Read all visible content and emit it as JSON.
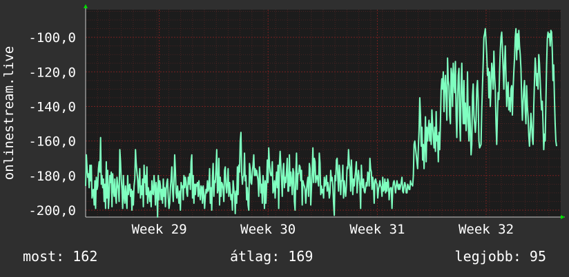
{
  "chart_data": {
    "type": "line",
    "ylabel": "onlinestream.live",
    "ylim": [
      -204,
      -84
    ],
    "yticks": [
      -100,
      -120,
      -140,
      -160,
      -180,
      -200
    ],
    "ytick_labels": [
      "-100,0",
      "-120,0",
      "-140,0",
      "-160,0",
      "-180,0",
      "-200,0"
    ],
    "xticks": [
      "Week 29",
      "Week 30",
      "Week 31",
      "Week 32"
    ],
    "xtick_positions": [
      0.155,
      0.384,
      0.614,
      0.843
    ],
    "grid": true,
    "colors": {
      "background": "#2f2f2f",
      "plot_bg": "#1c1c1c",
      "grid": "#7a2020",
      "line": "#7fffc0",
      "axis_arrow": "#00dd00"
    },
    "series": [
      {
        "values": [
          -186,
          -168,
          -176,
          -181,
          -179,
          -187,
          -174,
          -183,
          -174,
          -193,
          -190,
          -188,
          -197,
          -183,
          -199,
          -181,
          -188,
          -186,
          -176,
          -172,
          -178,
          -158,
          -185,
          -180,
          -187,
          -182,
          -195,
          -185,
          -199,
          -172,
          -193,
          -177,
          -199,
          -192,
          -180,
          -184,
          -178,
          -198,
          -179,
          -188,
          -192,
          -182,
          -192,
          -196,
          -181,
          -185,
          -188,
          -195,
          -165,
          -172,
          -182,
          -188,
          -199,
          -180,
          -192,
          -196,
          -186,
          -193,
          -199,
          -180,
          -191,
          -186,
          -185,
          -192,
          -188,
          -200,
          -189,
          -197,
          -186,
          -182,
          -165,
          -173,
          -178,
          -182,
          -190,
          -184,
          -176,
          -193,
          -186,
          -191,
          -182,
          -198,
          -174,
          -184,
          -180,
          -191,
          -175,
          -196,
          -187,
          -190,
          -195,
          -189,
          -198,
          -183,
          -190,
          -191,
          -180,
          -186,
          -197,
          -184,
          -189,
          -204,
          -180,
          -194,
          -183,
          -186,
          -194,
          -188,
          -196,
          -182,
          -192,
          -187,
          -198,
          -188,
          -184,
          -182,
          -193,
          -199,
          -196,
          -187,
          -182,
          -175,
          -188,
          -195,
          -184,
          -168,
          -177,
          -190,
          -193,
          -186,
          -191,
          -196,
          -189,
          -200,
          -184,
          -187,
          -186,
          -194,
          -180,
          -187,
          -181,
          -184,
          -190,
          -192,
          -181,
          -185,
          -179,
          -188,
          -172,
          -168,
          -193,
          -180,
          -196,
          -185,
          -191,
          -185,
          -186,
          -184,
          -192,
          -183,
          -190,
          -194,
          -186,
          -187,
          -196,
          -186,
          -191,
          -199,
          -192,
          -188,
          -190,
          -183,
          -189,
          -187,
          -176,
          -196,
          -187,
          -200,
          -181,
          -173,
          -192,
          -183,
          -184,
          -176,
          -165,
          -190,
          -188,
          -170,
          -197,
          -181,
          -192,
          -184,
          -185,
          -188,
          -195,
          -177,
          -175,
          -186,
          -190,
          -184,
          -176,
          -192,
          -184,
          -189,
          -194,
          -191,
          -200,
          -183,
          -188,
          -191,
          -202,
          -189,
          -196,
          -175,
          -191,
          -174,
          -178,
          -160,
          -155,
          -178,
          -185,
          -181,
          -180,
          -167,
          -183,
          -180,
          -194,
          -187,
          -197,
          -200,
          -173,
          -176,
          -184,
          -185,
          -178,
          -174,
          -168,
          -180,
          -176,
          -180,
          -177,
          -180,
          -183,
          -192,
          -175,
          -181,
          -190,
          -185,
          -196,
          -180,
          -185,
          -199,
          -183,
          -196,
          -186,
          -171,
          -184,
          -164,
          -173,
          -178,
          -180,
          -180,
          -172,
          -190,
          -188,
          -183,
          -193,
          -184,
          -178,
          -187,
          -174,
          -199,
          -174,
          -166,
          -174,
          -182,
          -192,
          -177,
          -173,
          -187,
          -181,
          -184,
          -177,
          -170,
          -189,
          -189,
          -168,
          -186,
          -178,
          -183,
          -191,
          -176,
          -178,
          -195,
          -200,
          -180,
          -167,
          -188,
          -179,
          -179,
          -174,
          -175,
          -183,
          -177,
          -197,
          -183,
          -185,
          -186,
          -188,
          -196,
          -189,
          -184,
          -181,
          -192,
          -173,
          -176,
          -197,
          -187,
          -178,
          -164,
          -184,
          -170,
          -172,
          -184,
          -181,
          -180,
          -183,
          -186,
          -167,
          -173,
          -191,
          -186,
          -190,
          -188,
          -193,
          -181,
          -186,
          -184,
          -180,
          -189,
          -184,
          -187,
          -193,
          -190,
          -177,
          -183,
          -181,
          -186,
          -196,
          -203,
          -180,
          -183,
          -171,
          -170,
          -181,
          -189,
          -174,
          -179,
          -191,
          -183,
          -183,
          -174,
          -193,
          -183,
          -188,
          -192,
          -186,
          -175,
          -176,
          -165,
          -173,
          -176,
          -189,
          -171,
          -181,
          -191,
          -182,
          -186,
          -181,
          -177,
          -172,
          -190,
          -182,
          -177,
          -182,
          -186,
          -199,
          -174,
          -183,
          -187,
          -182,
          -189,
          -190,
          -187,
          -184,
          -186,
          -178,
          -179,
          -186,
          -170,
          -176,
          -178,
          -188,
          -181,
          -185,
          -196,
          -183,
          -182,
          -184,
          -185,
          -193,
          -188,
          -186,
          -183,
          -186,
          -187,
          -192,
          -181,
          -189,
          -188,
          -182,
          -190,
          -184,
          -189,
          -182,
          -184,
          -194,
          -188,
          -187,
          -187,
          -199,
          -188,
          -184,
          -183,
          -186,
          -190,
          -186,
          -183,
          -186,
          -188,
          -185,
          -188,
          -186,
          -184,
          -181,
          -189,
          -190,
          -186,
          -184,
          -186,
          -190,
          -190,
          -185,
          -186,
          -188,
          -188,
          -183,
          -185,
          -185,
          -186,
          -180,
          -162,
          -160,
          -164,
          -168,
          -172,
          -176,
          -164,
          -154,
          -135,
          -145,
          -163,
          -152,
          -171,
          -162,
          -176,
          -163,
          -146,
          -172,
          -152,
          -160,
          -153,
          -148,
          -160,
          -150,
          -162,
          -142,
          -150,
          -158,
          -164,
          -152,
          -166,
          -143,
          -160,
          -157,
          -172,
          -155,
          -165,
          -149,
          -130,
          -124,
          -130,
          -120,
          -143,
          -128,
          -122,
          -135,
          -148,
          -112,
          -125,
          -128,
          -145,
          -150,
          -118,
          -122,
          -140,
          -115,
          -126,
          -132,
          -114,
          -145,
          -158,
          -136,
          -122,
          -118,
          -148,
          -160,
          -128,
          -115,
          -136,
          -150,
          -125,
          -150,
          -138,
          -154,
          -145,
          -120,
          -150,
          -160,
          -140,
          -152,
          -168,
          -162,
          -134,
          -127,
          -145,
          -150,
          -155,
          -148,
          -130,
          -125,
          -137,
          -160,
          -164,
          -163,
          -162,
          -142,
          -128,
          -115,
          -100,
          -98,
          -95,
          -102,
          -110,
          -122,
          -118,
          -135,
          -120,
          -140,
          -128,
          -115,
          -120,
          -130,
          -108,
          -122,
          -130,
          -150,
          -162,
          -145,
          -132,
          -136,
          -120,
          -108,
          -100,
          -97,
          -106,
          -118,
          -130,
          -115,
          -105,
          -122,
          -140,
          -130,
          -126,
          -142,
          -135,
          -143,
          -130,
          -128,
          -145,
          -130,
          -120,
          -112,
          -100,
          -95,
          -113,
          -98,
          -107,
          -96,
          -105,
          -110,
          -118,
          -135,
          -148,
          -138,
          -130,
          -125,
          -143,
          -150,
          -128,
          -140,
          -146,
          -157,
          -163,
          -155,
          -144,
          -150,
          -158,
          -162,
          -140,
          -125,
          -112,
          -118,
          -128,
          -121,
          -130,
          -110,
          -115,
          -125,
          -135,
          -142,
          -137,
          -150,
          -165,
          -156,
          -160,
          -138,
          -116,
          -101,
          -97,
          -100,
          -98,
          -105,
          -96,
          -97,
          -108,
          -125,
          -116,
          -135,
          -150,
          -160,
          -163
        ]
      }
    ]
  },
  "stats": {
    "now": "most: 162",
    "avg": "átlag: 169",
    "best": "legjobb: 95"
  }
}
